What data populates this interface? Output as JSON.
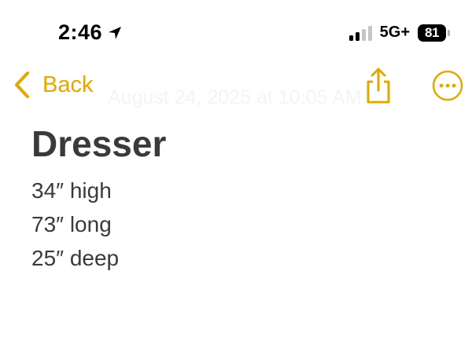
{
  "status_bar": {
    "time": "2:46",
    "location_icon": "location-arrow-icon",
    "signal_bars_active": 2,
    "signal_bars_total": 4,
    "network": "5G+",
    "battery_level": "81"
  },
  "nav": {
    "back_label": "Back",
    "date_text": "August 24, 2025 at 10:05 AM",
    "share_icon": "share-icon",
    "more_icon": "more-options-icon"
  },
  "note": {
    "title": "Dresser",
    "lines": [
      "34″ high",
      "73″ long",
      "25″ deep"
    ]
  },
  "colors": {
    "accent": "#e0a800",
    "text": "#3a3a3c"
  }
}
